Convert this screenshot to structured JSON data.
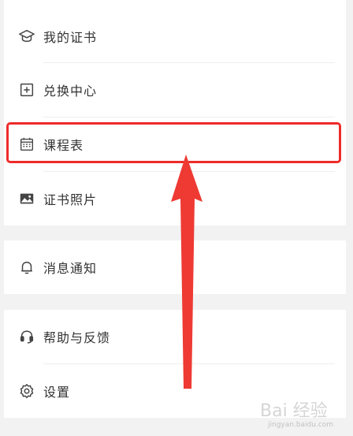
{
  "menu": {
    "items": [
      {
        "label": "我的证书",
        "icon": "graduation-cap-icon"
      },
      {
        "label": "兑换中心",
        "icon": "plus-square-icon"
      },
      {
        "label": "课程表",
        "icon": "calendar-icon"
      },
      {
        "label": "证书照片",
        "icon": "image-icon"
      },
      {
        "label": "消息通知",
        "icon": "bell-icon"
      },
      {
        "label": "帮助与反馈",
        "icon": "headset-icon"
      },
      {
        "label": "设置",
        "icon": "gear-icon"
      }
    ]
  },
  "colors": {
    "highlight": "#ee2b2b",
    "text": "#333333",
    "background": "#f2f2f2"
  },
  "watermark": {
    "text": "Bai 经验",
    "url": "jingyan.baidu.com"
  }
}
